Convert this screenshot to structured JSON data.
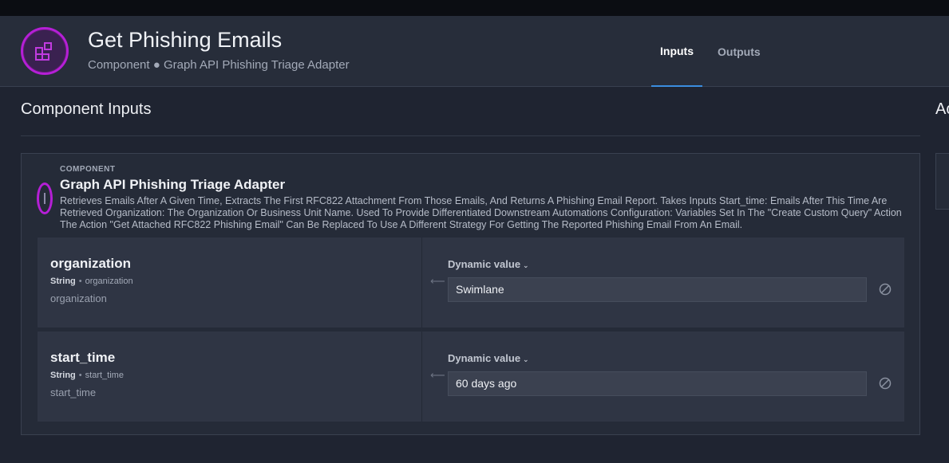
{
  "header": {
    "title": "Get Phishing Emails",
    "subtitle": "Component ● Graph API Phishing Triage Adapter",
    "avatar_icon": "component-blocks-icon",
    "accent_color": "#b51fd6",
    "tabs": [
      {
        "label": "Inputs",
        "active": true
      },
      {
        "label": "Outputs",
        "active": false
      }
    ]
  },
  "main": {
    "section_title": "Component Inputs",
    "right_section_title": "Ac",
    "component": {
      "kicker": "COMPONENT",
      "name": "Graph API Phishing Triage Adapter",
      "description": "Retrieves Emails After A Given Time, Extracts The First RFC822 Attachment From Those Emails, And Returns A Phishing Email Report. Takes Inputs Start_time: Emails After This Time Are Retrieved Organization: The Organization Or Business Unit Name. Used To Provide Differentiated Downstream Automations Configuration: Variables Set In The \"Create Custom Query\" Action The Action \"Get Attached RFC822 Phishing Email\" Can Be Replaced To Use A Different Strategy For Getting The Reported Phishing Email From An Email."
    },
    "inputs": [
      {
        "name": "organization",
        "type": "String",
        "key": "organization",
        "description": "organization",
        "value_mode": "Dynamic value",
        "value": "Swimlane"
      },
      {
        "name": "start_time",
        "type": "String",
        "key": "start_time",
        "description": "start_time",
        "value_mode": "Dynamic value",
        "value": "60 days ago"
      }
    ]
  }
}
